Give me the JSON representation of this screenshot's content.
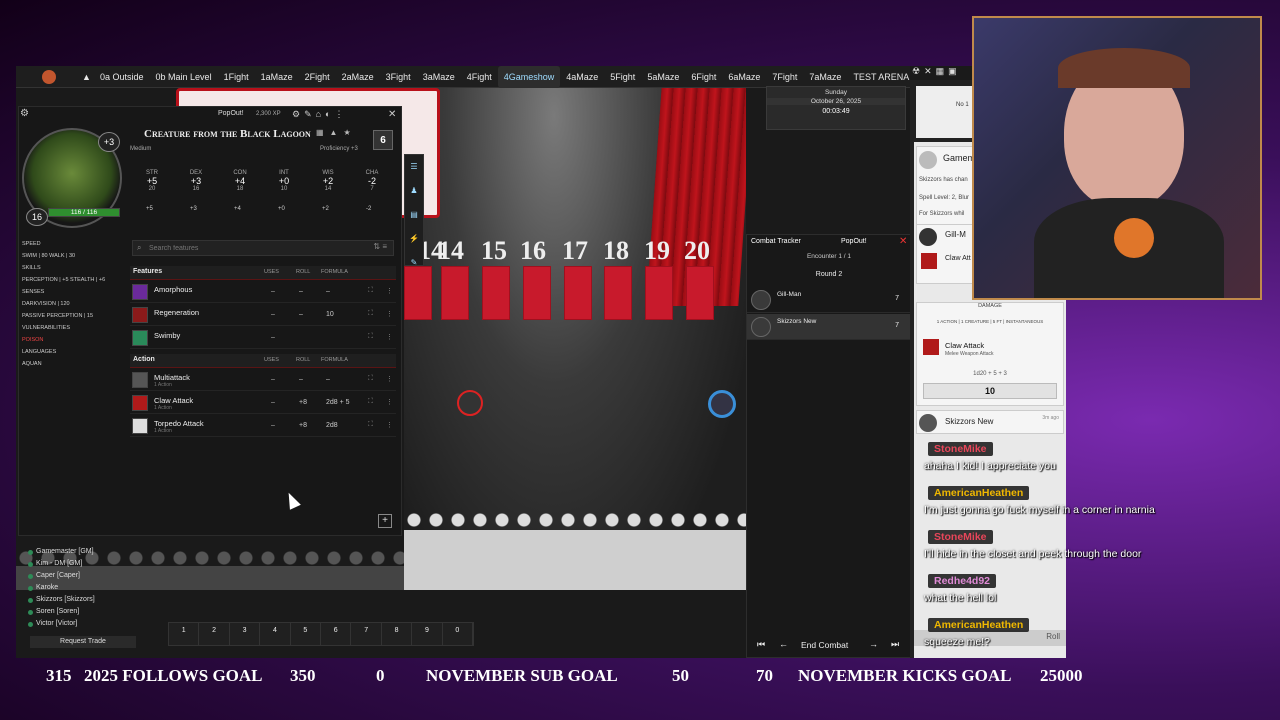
{
  "scenes": [
    "0a Outside",
    "0b Main Level",
    "1Fight",
    "1aMaze",
    "2Fight",
    "2aMaze",
    "3Fight",
    "3aMaze",
    "4Fight",
    "4Gameshow",
    "4aMaze",
    "5Fight",
    "5aMaze",
    "6Fight",
    "6aMaze",
    "7Fight",
    "7aMaze",
    "TEST ARENA"
  ],
  "stage_numbers": [
    "14",
    "15",
    "16",
    "17",
    "18",
    "19",
    "20"
  ],
  "calendar": {
    "day": "Sunday",
    "date": "October 26, 2025",
    "time": "00:03:49"
  },
  "sheet": {
    "popout": "PopOut!",
    "xp": "2,300 XP",
    "name": "Creature from the Black Lagoon",
    "size": "Medium",
    "proficiency": "Proficiency +3",
    "cr": "6",
    "ac_bonus": "+3",
    "level": "16",
    "hp": "116 / 116",
    "stats": [
      {
        "n": "STR",
        "m": "+5",
        "v": "20"
      },
      {
        "n": "DEX",
        "m": "+3",
        "v": "16"
      },
      {
        "n": "CON",
        "m": "+4",
        "v": "18"
      },
      {
        "n": "INT",
        "m": "+0",
        "v": "10"
      },
      {
        "n": "WIS",
        "m": "+2",
        "v": "14"
      },
      {
        "n": "CHA",
        "m": "-2",
        "v": "7"
      }
    ],
    "saves": [
      "+5",
      "+3",
      "+4",
      "+0",
      "+2",
      "-2"
    ],
    "speed_head": "SPEED",
    "speed": "SWIM | 80   WALK | 30",
    "skills_head": "SKILLS",
    "skills": [
      "PERCEPTION | +5   STEALTH | +6"
    ],
    "senses_head": "SENSES",
    "senses": [
      "DARKVISION | 120",
      "PASSIVE PERCEPTION | 15"
    ],
    "vuln_head": "VULNERABILITIES",
    "vuln": "POISON",
    "lang_head": "LANGUAGES",
    "lang": "AQUAN",
    "search_placeholder": "Search features",
    "features_head": "Features",
    "action_head": "Action",
    "col_uses": "USES",
    "col_roll": "ROLL",
    "col_formula": "FORMULA",
    "features": [
      {
        "name": "Amorphous",
        "sub": "",
        "uses": "–",
        "roll": "–",
        "formula": "–"
      },
      {
        "name": "Regeneration",
        "sub": "",
        "uses": "–",
        "roll": "–",
        "formula": "10"
      },
      {
        "name": "Swimby",
        "sub": "",
        "uses": "–",
        "roll": "",
        "formula": ""
      }
    ],
    "actions": [
      {
        "name": "Multiattack",
        "sub": "1 Action",
        "uses": "–",
        "roll": "–",
        "formula": "–"
      },
      {
        "name": "Claw Attack",
        "sub": "1 Action",
        "uses": "–",
        "roll": "+8",
        "formula": "2d8 + 5"
      },
      {
        "name": "Torpedo Attack",
        "sub": "1 Action",
        "uses": "–",
        "roll": "+8",
        "formula": "2d8"
      }
    ]
  },
  "players": [
    "Gamemaster [GM]",
    "Kim - DM [GM]",
    "Caper [Caper]",
    "Karoke",
    "Skizzors [Skizzors]",
    "Soren [Soren]",
    "Victor [Victor]"
  ],
  "request_trade": "Request Trade",
  "hotbar": [
    "1",
    "2",
    "3",
    "4",
    "5",
    "6",
    "7",
    "8",
    "9",
    "0"
  ],
  "combat": {
    "title": "Combat Tracker",
    "popout": "PopOut!",
    "encounter": "Encounter 1 / 1",
    "round": "Round 2",
    "combatants": [
      {
        "name": "Gill-Man",
        "init": "7"
      },
      {
        "name": "Skizzors New",
        "init": "7"
      }
    ],
    "end": "End Combat"
  },
  "chat": {
    "card_title": "Gamem",
    "card_text": "Skizzors has chan",
    "card_text2": "Spell Level: 2, Blur",
    "card_text3": "For Skizzors whil",
    "gill": "Gill-M",
    "claw": "Claw Att",
    "damage": "DAMAGE",
    "tags": "1 ACTION | 1 CREATURE | 5 FT | INSTANTANEOUS",
    "claw_title": "Claw Attack",
    "claw_sub": "Melee Weapon Attack",
    "formula": "1d20 + 5 + 3",
    "total": "10",
    "skizzors": "Skizzors New",
    "skiz_time": "3m ago",
    "roll_btn": "Roll",
    "no_label": "No 1"
  },
  "overlay": [
    {
      "user": "StoneMike",
      "msg": "ahaha I kid! I appreciate you",
      "color": "#e8465a"
    },
    {
      "user": "AmericanHeathen",
      "msg": "I'm just gonna go fuck myself in a corner in narnia",
      "color": "#f0b800"
    },
    {
      "user": "StoneMike",
      "msg": "I'll hide in the closet and peek through the door",
      "color": "#e8465a"
    },
    {
      "user": "Redhe4d92",
      "msg": "what the hell lol",
      "color": "#e08ad6"
    },
    {
      "user": "AmericanHeathen",
      "msg": "squeeze me!?",
      "color": "#f0b800"
    }
  ],
  "ticker": {
    "f_cur": "315",
    "f_label": "2025 FOLLOWS GOAL",
    "f_goal": "350",
    "s_cur": "0",
    "s_label": "NOVEMBER SUB GOAL",
    "s_goal": "50",
    "k_cur": "70",
    "k_label": "NOVEMBER KICKS GOAL",
    "k_goal": "25000"
  },
  "colors": {
    "accent": "#c0141c",
    "hp": "#2f8f2f",
    "ticker_bg": "#1a0a22"
  }
}
